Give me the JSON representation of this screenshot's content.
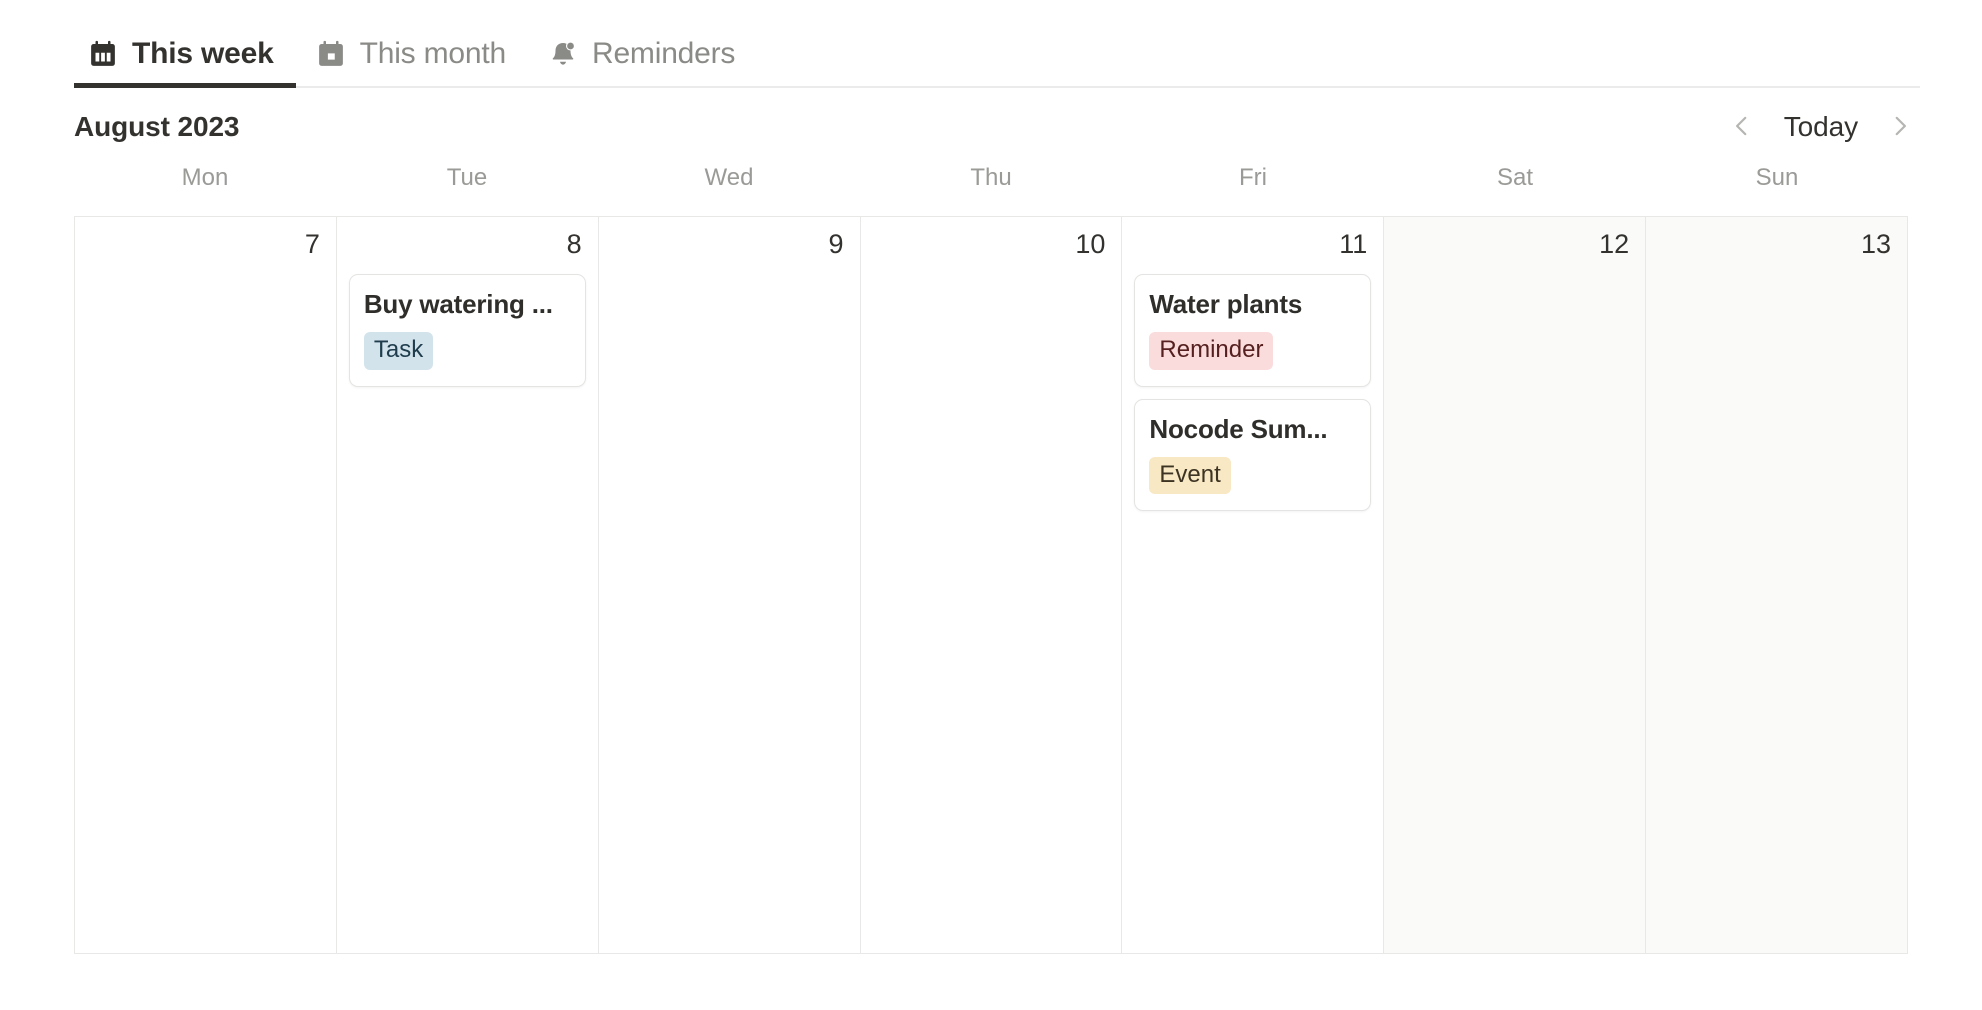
{
  "tabs": [
    {
      "label": "This week",
      "icon": "calendar-week-icon",
      "active": true
    },
    {
      "label": "This month",
      "icon": "calendar-month-icon",
      "active": false
    },
    {
      "label": "Reminders",
      "icon": "bell-icon",
      "active": false
    }
  ],
  "header": {
    "month_title": "August 2023",
    "prev_label": "chevron-left-icon",
    "today_label": "Today",
    "next_label": "chevron-right-icon"
  },
  "weekdays": [
    "Mon",
    "Tue",
    "Wed",
    "Thu",
    "Fri",
    "Sat",
    "Sun"
  ],
  "days": [
    {
      "number": "7",
      "weekend": false,
      "events": []
    },
    {
      "number": "8",
      "weekend": false,
      "events": [
        {
          "title": "Buy watering ...",
          "badge": "Task",
          "badge_type": "task"
        }
      ]
    },
    {
      "number": "9",
      "weekend": false,
      "events": []
    },
    {
      "number": "10",
      "weekend": false,
      "events": []
    },
    {
      "number": "11",
      "weekend": false,
      "events": [
        {
          "title": "Water plants",
          "badge": "Reminder",
          "badge_type": "reminder"
        },
        {
          "title": "Nocode Sum...",
          "badge": "Event",
          "badge_type": "event"
        }
      ]
    },
    {
      "number": "12",
      "weekend": true,
      "events": []
    },
    {
      "number": "13",
      "weekend": true,
      "events": []
    }
  ],
  "colors": {
    "text_primary": "#33322f",
    "text_muted": "#9a9a97",
    "border": "#e8e8e6",
    "weekend_bg": "#fafaf9",
    "badge_task_bg": "#d3e3ec",
    "badge_reminder_bg": "#fadcdc",
    "badge_event_bg": "#f8e8c4"
  }
}
